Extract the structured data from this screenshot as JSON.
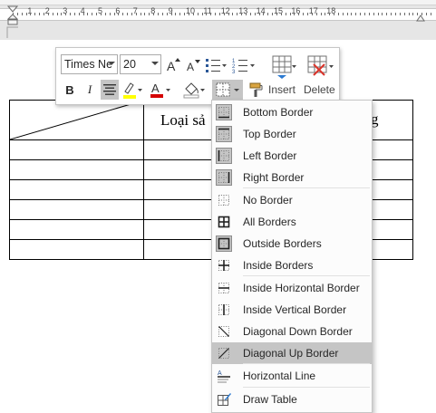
{
  "ruler": {
    "labels": [
      "1",
      "2",
      "3",
      "4",
      "5",
      "6",
      "7",
      "8",
      "9",
      "10",
      "11",
      "12",
      "13",
      "14",
      "15",
      "16",
      "17",
      "18"
    ]
  },
  "document": {
    "table_header_left": "Loại sả",
    "table_header_right": "g"
  },
  "mini_toolbar": {
    "font_name": "Times Ne",
    "font_size": "20",
    "insert_label": "Insert",
    "delete_label": "Delete",
    "bold": "B",
    "italic": "I",
    "font_color_letter": "A",
    "grow_font": "A",
    "shrink_font": "A",
    "highlight_color": "#ffff00",
    "font_color": "#d40000"
  },
  "border_menu": {
    "items": [
      {
        "label": "Bottom Border",
        "icon": "bottom-border-icon",
        "highlighted_icon": true
      },
      {
        "label": "Top Border",
        "icon": "top-border-icon",
        "highlighted_icon": true
      },
      {
        "label": "Left Border",
        "icon": "left-border-icon",
        "highlighted_icon": true
      },
      {
        "label": "Right Border",
        "icon": "right-border-icon",
        "highlighted_icon": true
      },
      {
        "label": "No Border",
        "icon": "no-border-icon",
        "highlighted_icon": false
      },
      {
        "label": "All Borders",
        "icon": "all-borders-icon",
        "highlighted_icon": false
      },
      {
        "label": "Outside Borders",
        "icon": "outside-borders-icon",
        "highlighted_icon": true
      },
      {
        "label": "Inside Borders",
        "icon": "inside-borders-icon",
        "highlighted_icon": false
      },
      {
        "label": "Inside Horizontal Border",
        "icon": "inside-horizontal-border-icon",
        "highlighted_icon": false
      },
      {
        "label": "Inside Vertical Border",
        "icon": "inside-vertical-border-icon",
        "highlighted_icon": false
      },
      {
        "label": "Diagonal Down Border",
        "icon": "diagonal-down-border-icon",
        "highlighted_icon": false
      },
      {
        "label": "Diagonal Up Border",
        "icon": "diagonal-up-border-icon",
        "highlighted_icon": false,
        "active": true
      },
      {
        "label": "Horizontal Line",
        "icon": "horizontal-line-icon",
        "highlighted_icon": false
      },
      {
        "label": "Draw Table",
        "icon": "draw-table-icon",
        "highlighted_icon": false
      }
    ]
  }
}
